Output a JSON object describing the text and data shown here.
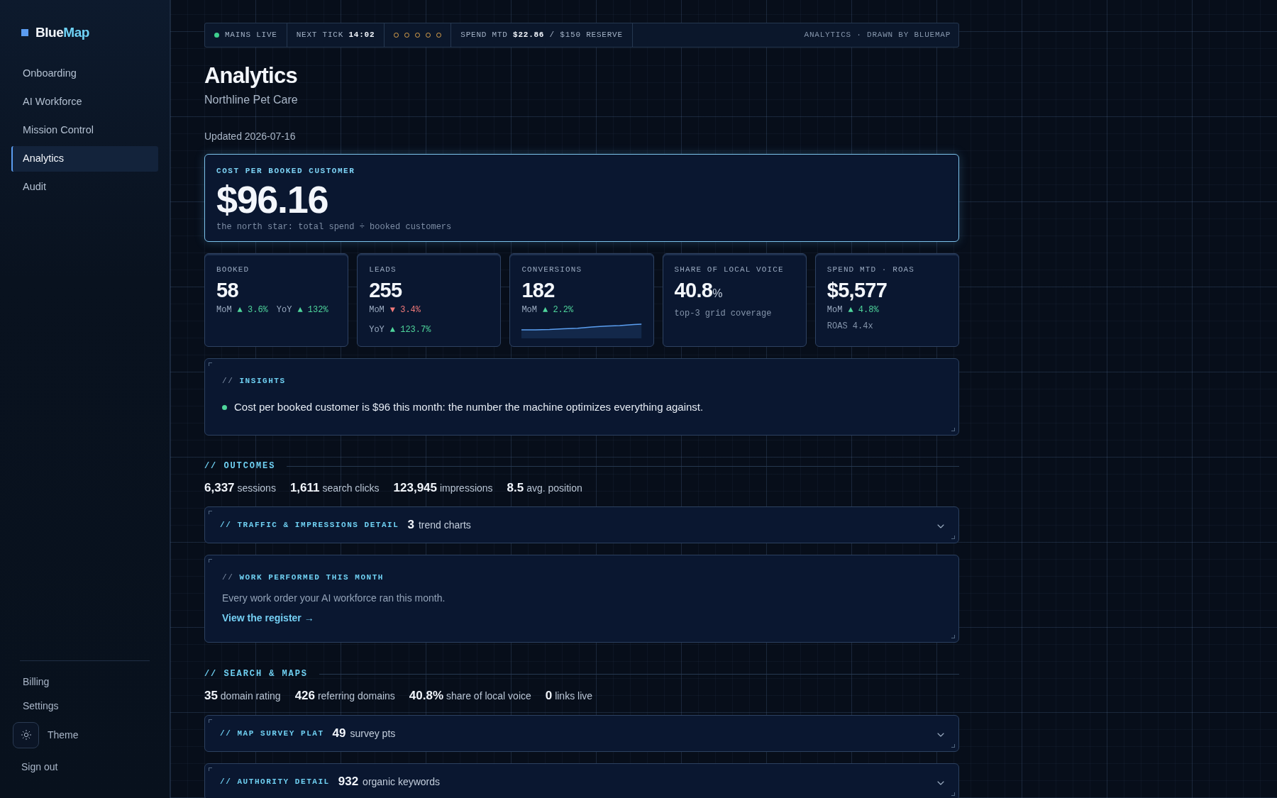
{
  "sidebar": {
    "logo": {
      "primary": "Blue",
      "accent": "Map"
    },
    "nav": [
      {
        "label": "Onboarding",
        "selected": false
      },
      {
        "label": "AI Workforce",
        "selected": false
      },
      {
        "label": "Mission Control",
        "selected": false
      },
      {
        "label": "Analytics",
        "selected": true
      },
      {
        "label": "Audit",
        "selected": false
      }
    ],
    "footer_links": [
      {
        "label": "Billing"
      },
      {
        "label": "Settings"
      }
    ],
    "theme_toggle": {
      "label": "Theme"
    },
    "sign_out": "Sign out"
  },
  "status_bar": {
    "live": {
      "label": "MAINS LIVE",
      "on": true
    },
    "next_tick": "NEXT TICK **14:02**",
    "pips": [
      {
        "filled": false
      },
      {
        "filled": false
      },
      {
        "filled": false
      },
      {
        "filled": false
      },
      {
        "filled": false
      }
    ],
    "spend": "SPEND MTD **$22.86** / $150 RESERVE",
    "caption": "ANALYTICS · DRAWN BY BLUEMAP"
  },
  "page": {
    "title": "Analytics",
    "subtitle": "Northline Pet Care",
    "updated": "Updated 2026-07-16"
  },
  "hero": {
    "label": "COST PER BOOKED CUSTOMER",
    "value": "$96.16",
    "caption": "the north star: total spend ÷ booked customers"
  },
  "kpis": [
    {
      "kind": "stat",
      "label": "BOOKED",
      "value": "58",
      "delta_rows": [
        [
          {
            "period": "MoM",
            "change": "▲ 3.6%",
            "positive": true
          },
          {
            "period": "YoY",
            "change": "▲ 132%",
            "positive": true
          }
        ]
      ]
    },
    {
      "kind": "stat",
      "label": "LEADS",
      "value": "255",
      "delta_rows": [
        [
          {
            "period": "MoM",
            "change": "▼ 3.4%",
            "positive": false
          }
        ],
        [
          {
            "period": "YoY",
            "change": "▲ 123.7%",
            "positive": true
          }
        ]
      ]
    },
    {
      "kind": "trend",
      "label": "CONVERSIONS",
      "value": "182",
      "delta_rows": [
        [
          {
            "period": "MoM",
            "change": "▲ 2.2%",
            "positive": true
          }
        ]
      ]
    },
    {
      "kind": "stat",
      "label": "SHARE OF LOCAL VOICE",
      "value": "40.8",
      "unit": "%",
      "note": "top-3 grid coverage"
    },
    {
      "kind": "stat",
      "label": "SPEND MTD · ROAS",
      "value": "$5,577",
      "delta_rows": [
        [
          {
            "period": "MoM",
            "change": "▲ 4.8%",
            "positive": true
          }
        ]
      ],
      "note": "ROAS 4.4x"
    }
  ],
  "insights": {
    "prefix": "//",
    "title": "INSIGHTS",
    "items": [
      {
        "text": "Cost per booked customer is $96 this month: the number the machine optimizes everything against."
      }
    ]
  },
  "outcomes": {
    "prefix": "//",
    "title": "OUTCOMES",
    "stats": [
      {
        "figure": "6,337",
        "caption": "sessions"
      },
      {
        "figure": "1,611",
        "caption": "search clicks"
      },
      {
        "figure": "123,945",
        "caption": "impressions"
      },
      {
        "figure": "8.5",
        "caption": "avg. position"
      }
    ],
    "details": [
      {
        "prefix": "//",
        "title": "TRAFFIC & IMPRESSIONS DETAIL",
        "count": "3",
        "count_label": "trend charts",
        "expanded": false
      }
    ]
  },
  "work_performed": {
    "prefix": "//",
    "title": "WORK PERFORMED THIS MONTH",
    "description": "Every work order your AI workforce ran this month.",
    "link": "View the register →"
  },
  "search_maps": {
    "prefix": "//",
    "title": "SEARCH & MAPS",
    "stats": [
      {
        "figure": "35",
        "caption": "domain rating"
      },
      {
        "figure": "426",
        "caption": "referring domains"
      },
      {
        "figure": "40.8%",
        "caption": "share of local voice"
      },
      {
        "figure": "0",
        "caption": "links live"
      }
    ],
    "details": [
      {
        "prefix": "//",
        "title": "MAP SURVEY PLAT",
        "count": "49",
        "count_label": "survey pts",
        "expanded": false
      },
      {
        "prefix": "//",
        "title": "AUTHORITY DETAIL",
        "count": "932",
        "count_label": "organic keywords",
        "expanded": false
      }
    ]
  }
}
